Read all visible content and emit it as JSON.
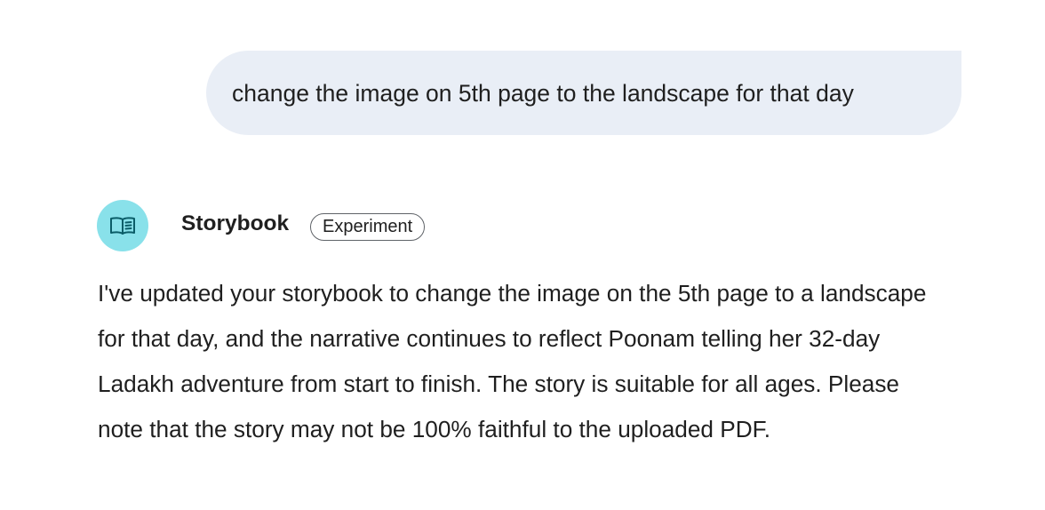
{
  "user_message": {
    "text": "change the image on 5th page to the landscape for that day"
  },
  "agent": {
    "icon": "open-book-icon",
    "name": "Storybook",
    "badge": "Experiment",
    "avatar_color": "#89e1ea"
  },
  "response": {
    "text": "I've updated your storybook to change the image on the 5th page to a landscape for that day, and the narrative continues to reflect Poonam telling her 32-day Ladakh adventure from start to finish. The story is suitable for all ages. Please note that the story may not be 100% faithful to the uploaded PDF."
  },
  "colors": {
    "user_bubble": "#e9eef6",
    "text": "#1f1f1f",
    "icon_stroke": "#0b5d68"
  }
}
